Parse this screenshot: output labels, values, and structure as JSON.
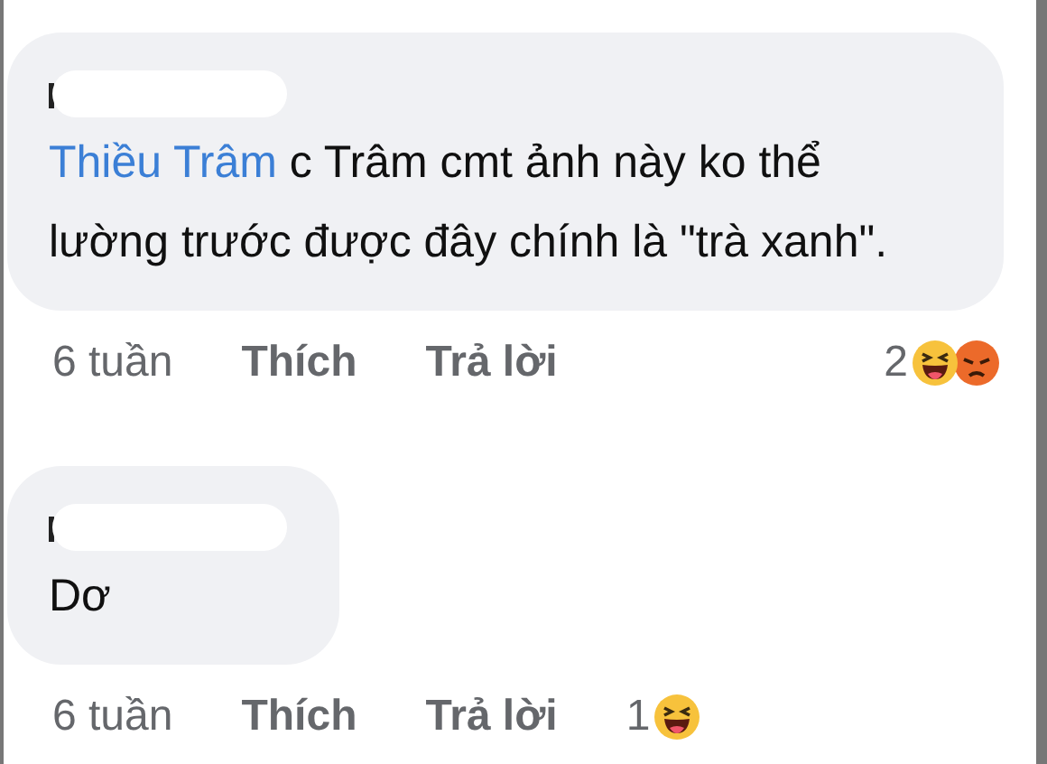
{
  "comments": [
    {
      "redacted_name": true,
      "mention": "Thiều Trâm",
      "text": "c Trâm cmt ảnh này ko thể lường trước được đây chính là \"trà xanh\".",
      "time": "6 tuần",
      "like": "Thích",
      "reply": "Trả lời",
      "reaction_count": "2",
      "reactions": [
        {
          "kind": "haha"
        },
        {
          "kind": "angry"
        }
      ]
    },
    {
      "redacted_name": true,
      "text": "Dơ",
      "time": "6 tuần",
      "like": "Thích",
      "reply": "Trả lời",
      "reaction_count": "1",
      "reactions": [
        {
          "kind": "haha"
        }
      ]
    }
  ]
}
